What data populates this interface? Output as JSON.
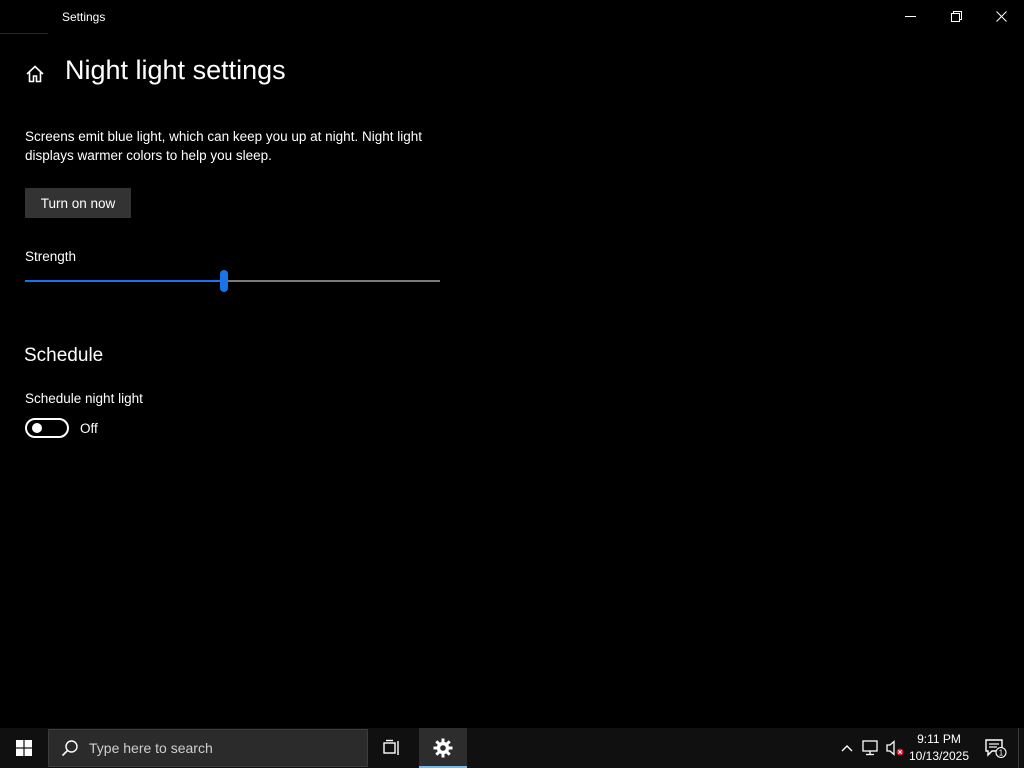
{
  "window": {
    "app_title": "Settings",
    "minimize_label": "—",
    "restore_label": "❐",
    "close_label": "✕"
  },
  "page": {
    "title": "Night light settings",
    "description": "Screens emit blue light, which can keep you up at night. Night light displays warmer colors to help you sleep.",
    "turn_on_button": "Turn on now",
    "strength_label": "Strength",
    "strength_value_fraction": 0.48
  },
  "schedule": {
    "heading": "Schedule",
    "toggle_label": "Schedule night light",
    "toggle_state": "Off",
    "toggle_on": false
  },
  "taskbar": {
    "search_placeholder": "Type here to search",
    "clock_time": "9:11 PM",
    "clock_date": "10/13/2025",
    "notification_count": "1"
  },
  "colors": {
    "accent": "#1a73e8",
    "background": "#000000",
    "taskbar": "#101010",
    "button": "#333333"
  },
  "icons": {
    "home": "home-icon",
    "start": "windows-logo-icon",
    "search": "search-icon",
    "task_view": "task-view-icon",
    "settings": "gear-icon",
    "tray_chevron": "chevron-up-icon",
    "network": "network-disconnected-icon",
    "volume": "volume-muted-icon",
    "notifications": "action-center-icon"
  }
}
